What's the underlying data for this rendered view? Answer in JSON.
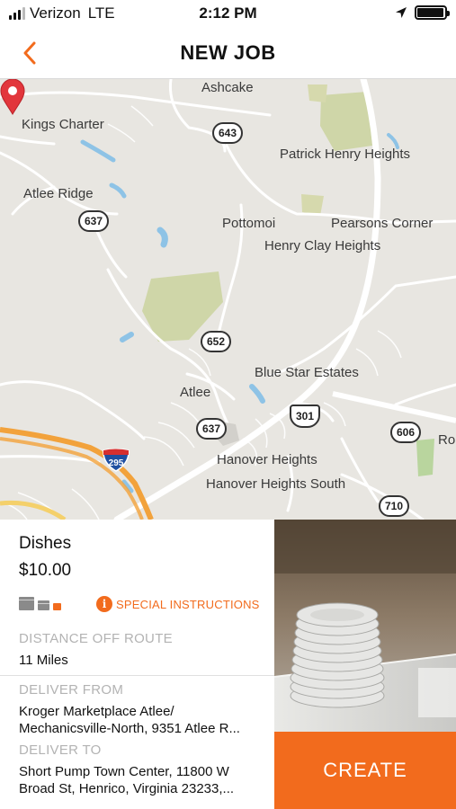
{
  "status_bar": {
    "carrier": "Verizon",
    "network": "LTE",
    "time": "2:12 PM",
    "signal_bars": 3,
    "battery_level": 0.95
  },
  "nav": {
    "title": "NEW JOB",
    "back_icon": "chevron-left-icon",
    "accent_color": "#F26B1D"
  },
  "map": {
    "labels": {
      "ashcake": "Ashcake",
      "kings_charter": "Kings Charter",
      "patrick_henry_heights": "Patrick Henry Heights",
      "atlee_ridge": "Atlee Ridge",
      "pottomoi": "Pottomoi",
      "pearsons_corner": "Pearsons Corner",
      "henry_clay_heights": "Henry Clay Heights",
      "blue_star_estates": "Blue Star Estates",
      "atlee": "Atlee",
      "hanover_heights": "Hanover Heights",
      "hanover_heights_south": "Hanover Heights South",
      "rol": "Rol"
    },
    "shields": {
      "r643": "643",
      "r637a": "637",
      "r652": "652",
      "r637b": "637",
      "us301": "301",
      "r606": "606",
      "i295": "295",
      "r710": "710"
    },
    "pin_icon": "map-pin-icon"
  },
  "job": {
    "item_name": "Dishes",
    "price": "$10.00",
    "size_icons": "package-size-icon",
    "special_instructions": "SPECIAL INSTRUCTIONS",
    "distance_label": "DISTANCE OFF ROUTE",
    "distance_value": "11 Miles",
    "deliver_from_label": "DELIVER FROM",
    "deliver_from_line1": "Kroger Marketplace Atlee/",
    "deliver_from_line2": "Mechanicsville-North, 9351 Atlee R...",
    "deliver_to_label": "DELIVER TO",
    "deliver_to_line1": "Short Pump Town Center, 11800 W",
    "deliver_to_line2": "Broad St, Henrico, Virginia 23233,..."
  },
  "photo": {
    "subject": "stacked-plates-image"
  },
  "create_button": {
    "label": "CREATE"
  }
}
